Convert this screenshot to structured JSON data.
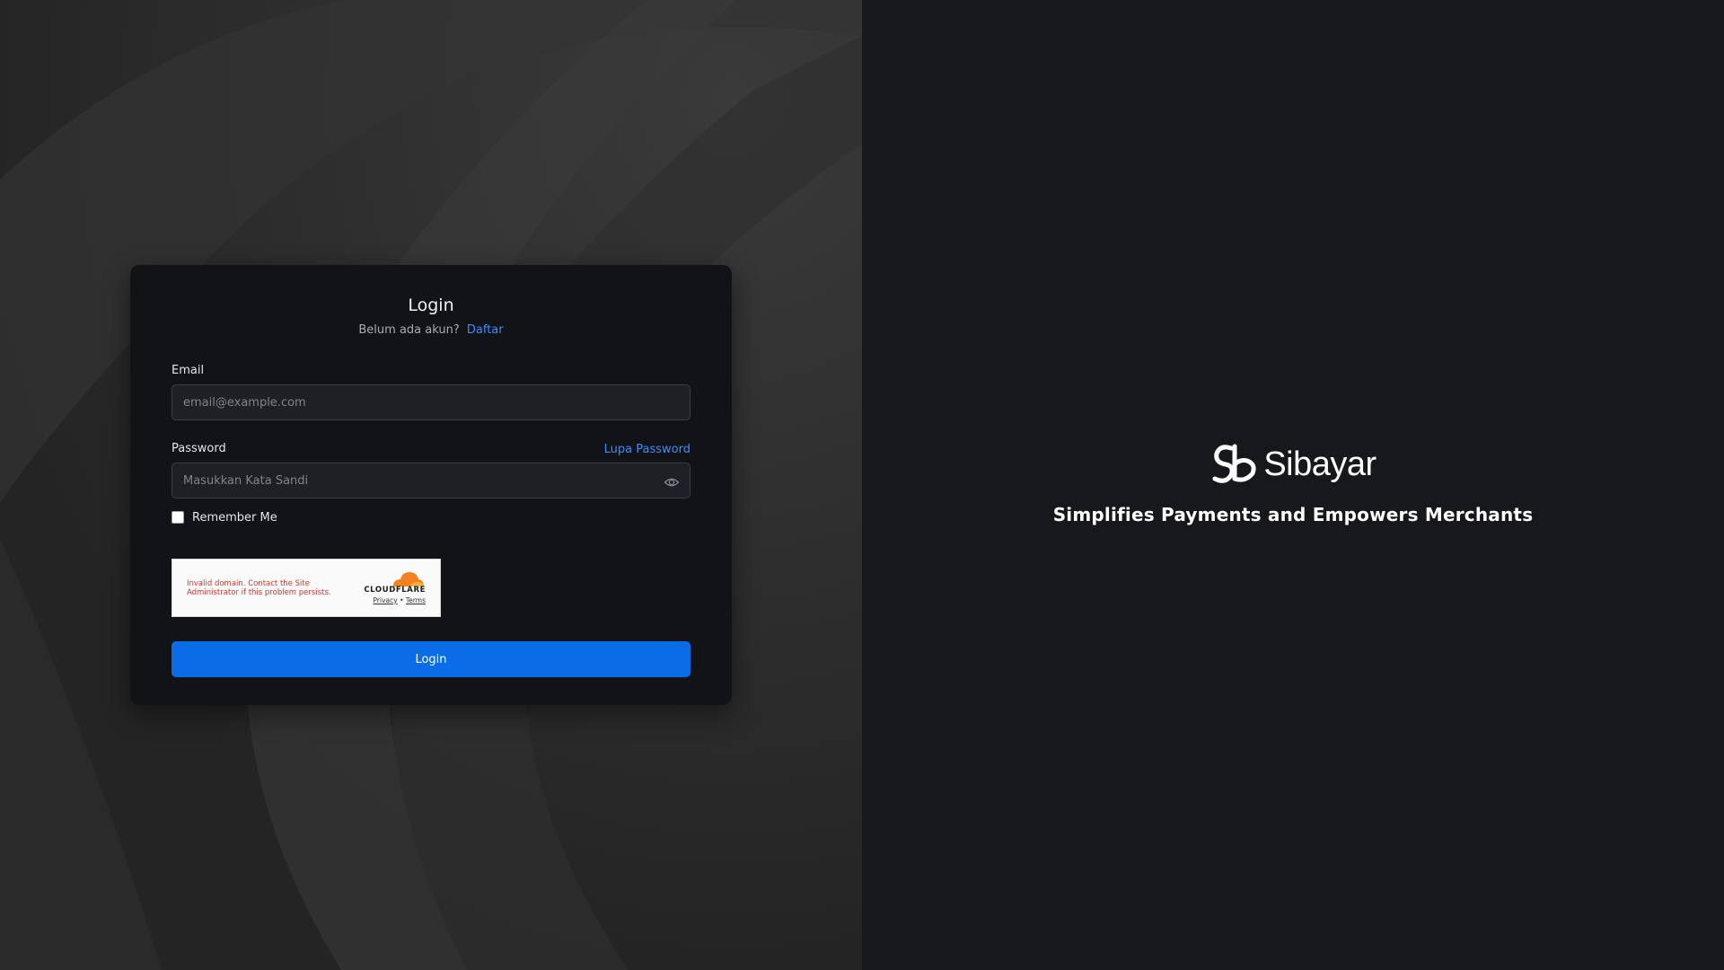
{
  "login_card": {
    "title": "Login",
    "register_prompt": "Belum ada akun?",
    "register_link": "Daftar",
    "email_label": "Email",
    "email_placeholder": "email@example.com",
    "password_label": "Password",
    "forgot_password_link": "Lupa Password",
    "password_placeholder": "Masukkan Kata Sandi",
    "remember_label": "Remember Me",
    "remember_checked": false,
    "submit_label": "Login"
  },
  "captcha": {
    "error_text": "Invalid domain. Contact the Site Administrator if this problem persists.",
    "provider_name": "CLOUDFLARE",
    "privacy_link": "Privacy",
    "separator": "•",
    "terms_link": "Terms"
  },
  "brand": {
    "name": "Sibayar",
    "tagline": "Simplifies Payments and Empowers Merchants"
  },
  "colors": {
    "accent": "#0a6ce6",
    "link": "#3a8cff",
    "card_bg": "#121317",
    "page_bg": "#17181c",
    "error": "#d2342a",
    "cloudflare_orange": "#f48120"
  },
  "icons": {
    "password_toggle": "eye-icon",
    "brand_logo": "sibayar-logo-icon",
    "captcha_logo": "cloudflare-cloud-icon"
  }
}
